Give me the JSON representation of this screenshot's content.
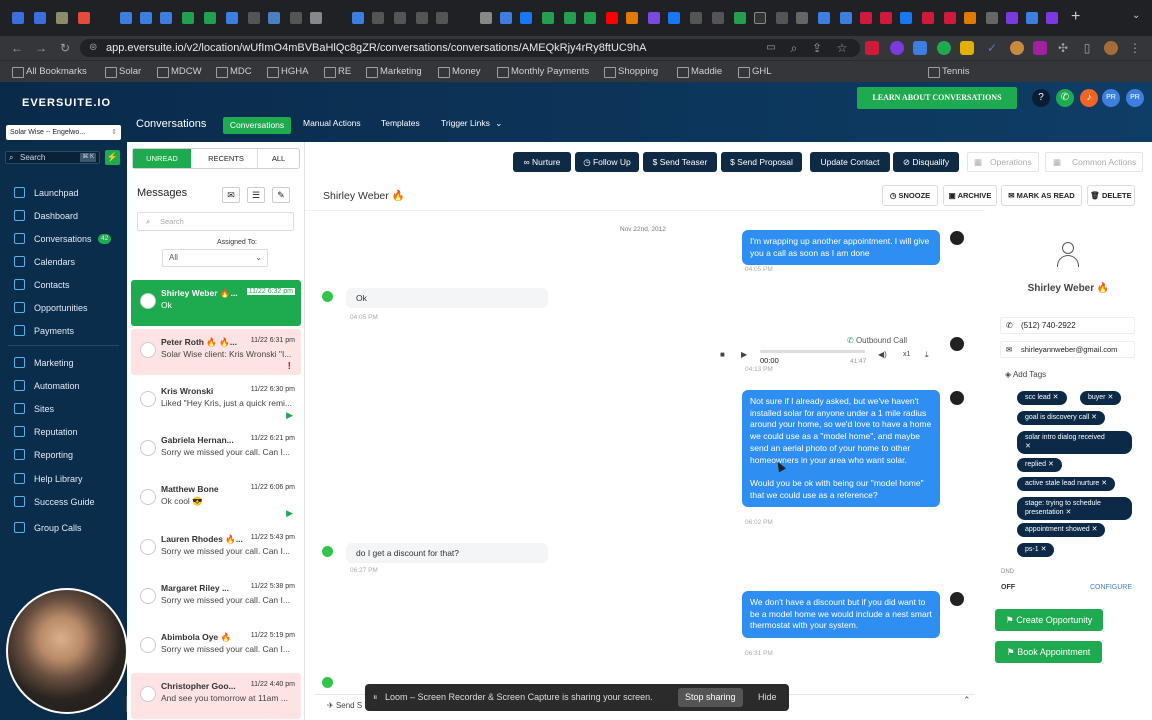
{
  "browser": {
    "url": "app.eversuite.io/v2/location/wUfImO4mBVBaHlQc8gZR/conversations/conversations/AMEQkRjy4rRy8ftUC9hA",
    "bookmarks": [
      "All Bookmarks",
      "Solar",
      "MDCW",
      "MDC",
      "HGHA",
      "RE",
      "Marketing",
      "Money",
      "Monthly Payments",
      "Shopping",
      "Maddie",
      "GHL",
      "Tennis"
    ]
  },
  "app": {
    "logo": "EVERSUITE.IO",
    "section_title": "Conversations",
    "nav_tabs": [
      "Conversations",
      "Manual Actions",
      "Templates",
      "Trigger Links"
    ],
    "learn_button": "LEARN ABOUT CONVERSATIONS",
    "location_selector": "Solar Wise -- Engelwo...",
    "search_placeholder": "Search",
    "search_shortcut": "⌘ K"
  },
  "sidebar": {
    "items": [
      {
        "label": "Launchpad"
      },
      {
        "label": "Dashboard"
      },
      {
        "label": "Conversations",
        "badge": "42"
      },
      {
        "label": "Calendars"
      },
      {
        "label": "Contacts"
      },
      {
        "label": "Opportunities"
      },
      {
        "label": "Payments"
      },
      {
        "label": "Marketing"
      },
      {
        "label": "Automation"
      },
      {
        "label": "Sites"
      },
      {
        "label": "Reputation"
      },
      {
        "label": "Reporting"
      },
      {
        "label": "Help Library"
      },
      {
        "label": "Success Guide"
      },
      {
        "label": "Group Calls"
      }
    ]
  },
  "list": {
    "filters": [
      "UNREAD",
      "RECENTS",
      "ALL"
    ],
    "heading": "Messages",
    "search_placeholder": "Search",
    "assigned_label": "Assigned To:",
    "assigned_value": "All",
    "conversations": [
      {
        "name": "Shirley Weber 🔥...",
        "time": "11/22 6:32 pm",
        "preview": "Ok",
        "selected": true
      },
      {
        "name": "Peter Roth 🔥 🔥...",
        "time": "11/22 6:31 pm",
        "preview": "Solar Wise client: Kris Wronski \"I...",
        "pink": true
      },
      {
        "name": "Kris Wronski",
        "time": "11/22 6:30 pm",
        "preview": "Liked \"Hey Kris, just a quick remi..."
      },
      {
        "name": "Gabriela Hernan...",
        "time": "11/22 6:21 pm",
        "preview": "Sorry we missed your call. Can I..."
      },
      {
        "name": "Matthew Bone",
        "time": "11/22 6:06 pm",
        "preview": "Ok cool 😎"
      },
      {
        "name": "Lauren Rhodes 🔥...",
        "time": "11/22 5:43 pm",
        "preview": "Sorry we missed your call. Can I..."
      },
      {
        "name": "Margaret Riley ...",
        "time": "11/22 5:38 pm",
        "preview": "Sorry we missed your call. Can I..."
      },
      {
        "name": "Abimbola Oye 🔥",
        "time": "11/22 5:19 pm",
        "preview": "Sorry we missed your call. Can I..."
      },
      {
        "name": "Christopher Goo...",
        "time": "11/22 4:40 pm",
        "preview": "And see you tomorrow at 11am ...",
        "pink": true
      }
    ]
  },
  "toolbar": {
    "actions": [
      "Nurture",
      "Follow Up",
      "Send Teaser",
      "Send Proposal",
      "Update Contact",
      "Disqualify"
    ],
    "operations": "Operations",
    "common_actions": "Common Actions",
    "secondary": [
      "SNOOZE",
      "ARCHIVE",
      "MARK AS READ",
      "DELETE"
    ]
  },
  "chat": {
    "contact_name": "Shirley Weber 🔥",
    "date_divider": "Nov 22nd, 2012",
    "messages": [
      {
        "dir": "out",
        "text": "I'm wrapping up another appointment. I will give you a call as soon as I am done",
        "time": "04:05 PM"
      },
      {
        "dir": "in",
        "text": "Ok",
        "time": "04:05 PM"
      },
      {
        "dir": "call",
        "label": "Outbound Call",
        "elapsed": "00:00",
        "duration": "41:47",
        "speed": "x1",
        "time": "04:13 PM"
      },
      {
        "dir": "out",
        "text": "Not sure if I already asked, but we've haven't installed solar for anyone under a 1 mile radius around your home, so we'd love to have a home we could use as a \"model home\", and maybe send an aerial photo of your home to other homeowners in your area who want solar.\n\nWould you be ok with being our \"model home\" that we could use as a reference?",
        "time": "06:02 PM"
      },
      {
        "dir": "in",
        "text": "do I get a discount for that?",
        "time": "06:27 PM"
      },
      {
        "dir": "out",
        "text": "We don't have a discount but if you did want to be a model home we would include a nest smart thermostat with your system.",
        "time": "06:31 PM"
      }
    ]
  },
  "contact": {
    "name": "Shirley Weber 🔥",
    "phone": "(512) 740-2922",
    "email": "shirleyannweber@gmail.com",
    "add_tags": "Add Tags",
    "tags": [
      "scc lead",
      "buyer",
      "goal is discovery call",
      "solar intro dialog received",
      "replied",
      "active stale lead nurture",
      "stage: trying to schedule presentation",
      "appointment showed",
      "ps-1"
    ],
    "dnd_label": "DND",
    "dnd_value": "OFF",
    "configure": "CONFIGURE",
    "create_opportunity": "Create Opportunity",
    "book_appointment": "Book Appointment"
  },
  "footer": {
    "send_label": "Send S",
    "share_text": "Loom – Screen Recorder & Screen Capture is sharing your screen.",
    "stop_button": "Stop sharing",
    "hide_button": "Hide"
  },
  "colors": {
    "accent": "#2f8ef2",
    "nav_dark": "#0b2d4c",
    "green": "#1eaa4f",
    "pill_dark": "#0c2a47"
  }
}
